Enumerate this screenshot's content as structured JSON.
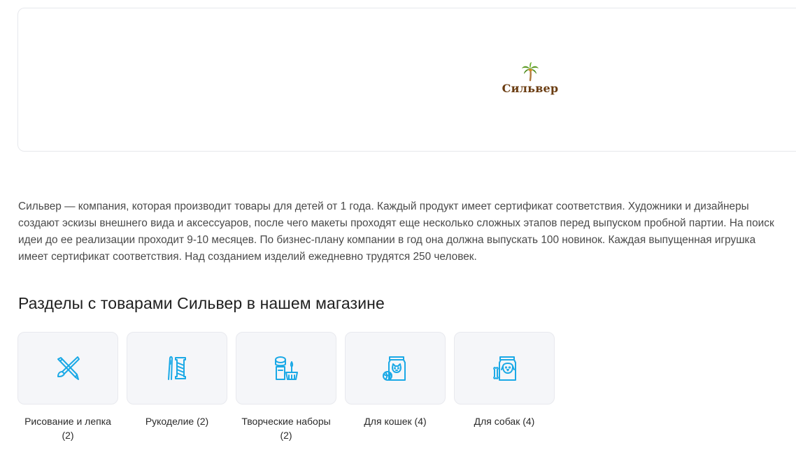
{
  "brand": {
    "name": "Сильвер",
    "logo_icon": "palm-tree-icon"
  },
  "description": "Сильвер — компания, которая производит товары для детей от 1 года. Каждый продукт имеет сертификат соответствия. Художники и дизайнеры создают эскизы внешнего вида и аксессуаров, после чего макеты проходят еще несколько сложных этапов перед выпуском пробной партии. На поиск идеи до ее реализации проходит 9-10 месяцев. По бизнес-плану компании в год она должна выпускать 100 новинок. Каждая выпущенная игрушка имеет сертификат соответствия. Над созданием изделий ежедневно трудятся 250 человек.",
  "sections": {
    "title": "Разделы с товарами Сильвер в нашем магазине",
    "accent_color": "#1ba9e6",
    "items": [
      {
        "label": "Рисование и лепка (2)",
        "icon": "brush-pencil-icon"
      },
      {
        "label": "Рукоделие (2)",
        "icon": "needle-thread-icon"
      },
      {
        "label": "Творческие наборы (2)",
        "icon": "creative-kit-icon"
      },
      {
        "label": "Для кошек (4)",
        "icon": "cat-food-icon"
      },
      {
        "label": "Для собак (4)",
        "icon": "dog-food-icon"
      }
    ]
  }
}
